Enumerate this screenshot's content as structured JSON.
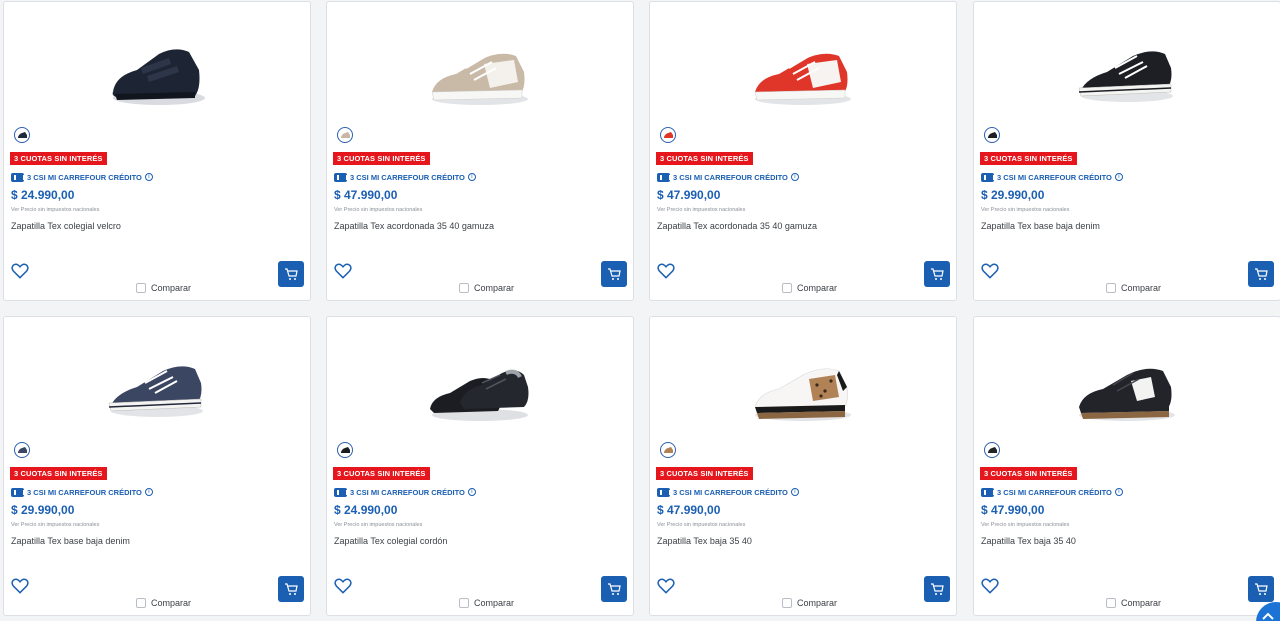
{
  "labels": {
    "cuotas_badge": "3 CUOTAS SIN INTERÉS",
    "csi_text": "3 CSI MI CARREFOUR CRÉDITO",
    "info_symbol": "i",
    "tax_note": "Ver Precio sin impuestos nacionales",
    "compare": "Comparar"
  },
  "colors": {
    "brand_blue": "#1b5fb3",
    "badge_red": "#e5161c"
  },
  "products": [
    {
      "name": "Zapatilla Tex colegial velcro",
      "price": "$ 24.990,00",
      "image_icon": "shoe-black-velcro-icon",
      "swatch_color": "#1e2a3a"
    },
    {
      "name": "Zapatilla Tex acordonada 35 40 gamuza",
      "price": "$ 47.990,00",
      "image_icon": "shoe-beige-suede-icon",
      "swatch_color": "#c8b7a3"
    },
    {
      "name": "Zapatilla Tex acordonada 35 40 gamuza",
      "price": "$ 47.990,00",
      "image_icon": "shoe-red-suede-icon",
      "swatch_color": "#e0362a"
    },
    {
      "name": "Zapatilla Tex base baja denim",
      "price": "$ 29.990,00",
      "image_icon": "shoe-black-canvas-icon",
      "swatch_color": "#1d1f24"
    },
    {
      "name": "Zapatilla Tex base baja denim",
      "price": "$ 29.990,00",
      "image_icon": "shoe-navy-denim-icon",
      "swatch_color": "#3b4762"
    },
    {
      "name": "Zapatilla Tex colegial cordón",
      "price": "$ 24.990,00",
      "image_icon": "shoe-black-laced-icon",
      "swatch_color": "#1b1d22"
    },
    {
      "name": "Zapatilla Tex baja 35 40",
      "price": "$ 47.990,00",
      "image_icon": "shoe-white-leopard-icon",
      "swatch_color": "#b08256"
    },
    {
      "name": "Zapatilla Tex baja 35 40",
      "price": "$ 47.990,00",
      "image_icon": "shoe-black-gum-icon",
      "swatch_color": "#22242a"
    }
  ]
}
